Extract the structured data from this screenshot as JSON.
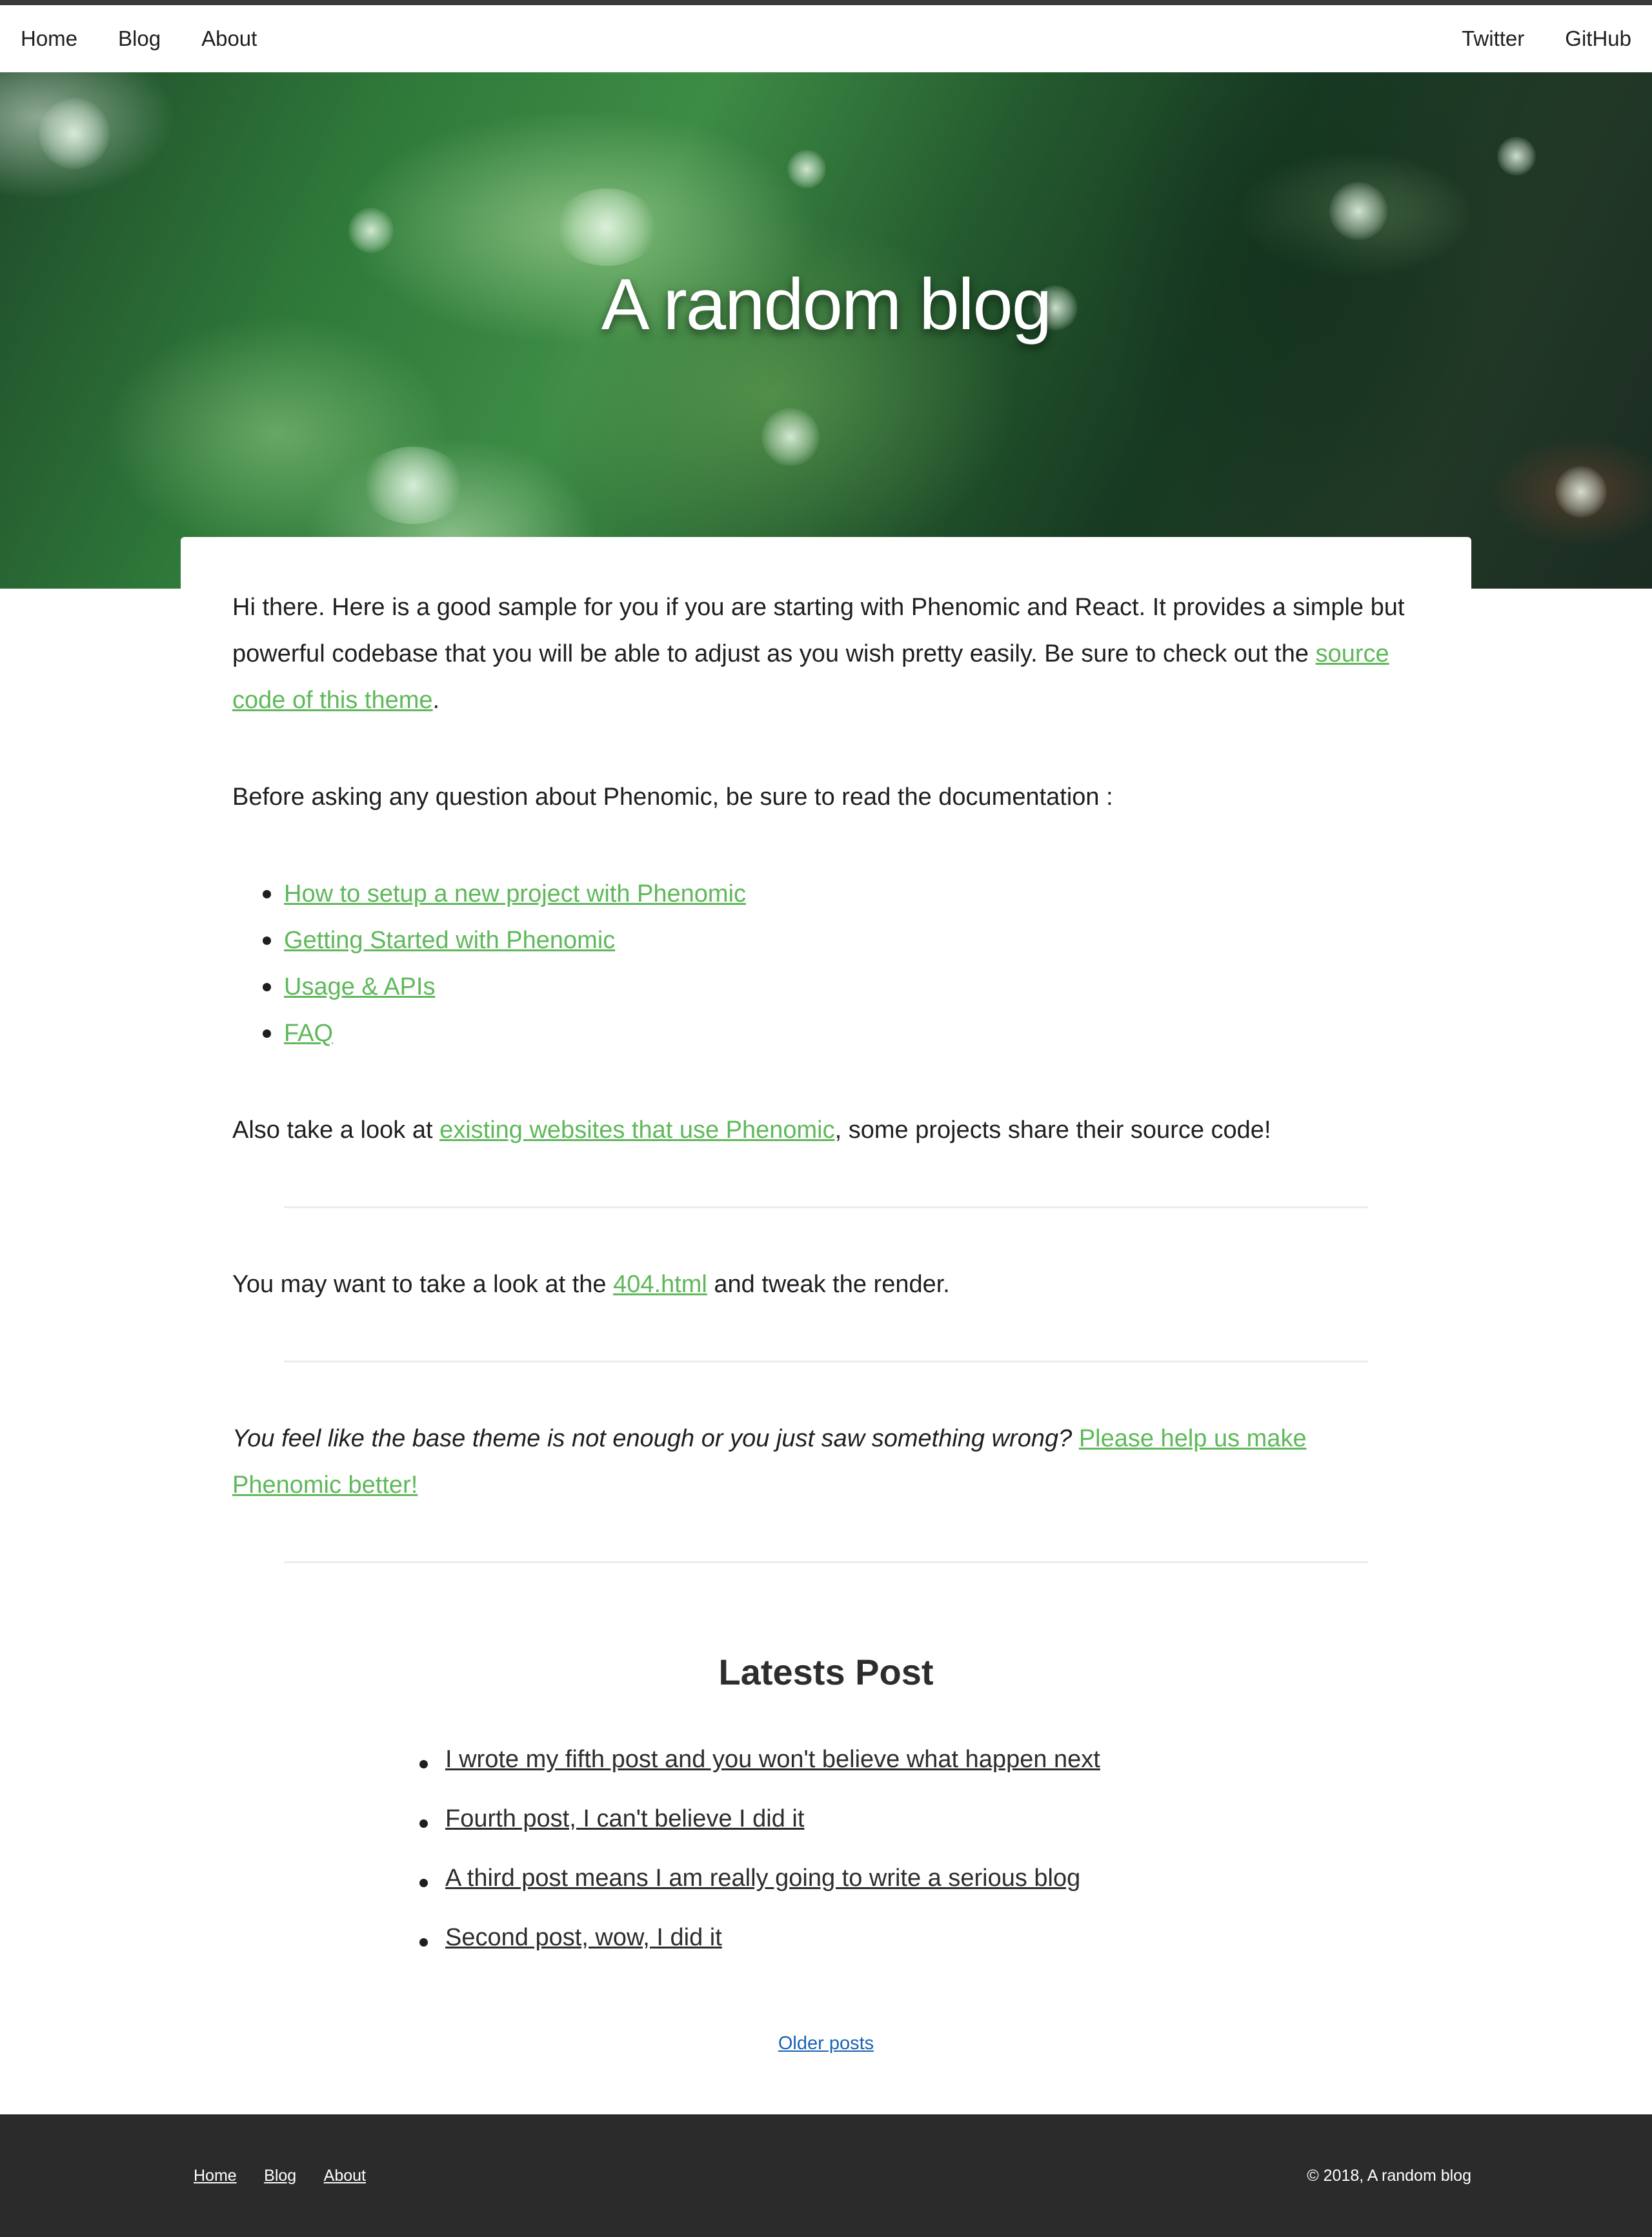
{
  "header": {
    "nav_left": [
      "Home",
      "Blog",
      "About"
    ],
    "nav_right": [
      "Twitter",
      "GitHub"
    ]
  },
  "hero": {
    "title": "A random blog"
  },
  "intro": {
    "p1_text": "Hi there. Here is a good sample for you if you are starting with Phenomic and React. It provides a simple but powerful codebase that you will be able to adjust as you wish pretty easily. Be sure to check out the ",
    "p1_link": "source code of this theme",
    "p1_end": ".",
    "p2_text": "Before asking any question about Phenomic, be sure to read the documentation :",
    "doc_links": [
      "How to setup a new project with Phenomic",
      "Getting Started with Phenomic",
      "Usage & APIs",
      "FAQ"
    ],
    "p3_text": "Also take a look at ",
    "p3_link": "existing websites that use Phenomic",
    "p3_end": ", some projects share their source code!",
    "p4_text": "You may want to take a look at the ",
    "p4_link": "404.html",
    "p4_end": " and tweak the render.",
    "p5_text": "You feel like the base theme is not enough or you just saw something wrong? ",
    "p5_link": "Please help us make Phenomic better!"
  },
  "posts": {
    "title": "Latests Post",
    "items": [
      "I wrote my fifth post and you won't believe what happen next",
      "Fourth post, I can't believe I did it",
      "A third post means I am really going to write a serious blog",
      "Second post, wow, I did it"
    ],
    "older_label": "Older posts"
  },
  "footer": {
    "nav": [
      "Home",
      "Blog",
      "About"
    ],
    "copyright": "© 2018, A random blog"
  },
  "colors": {
    "link_green": "#5fb85a",
    "older_link_blue": "#1a62b5",
    "footer_bg": "#2b2b2b"
  }
}
